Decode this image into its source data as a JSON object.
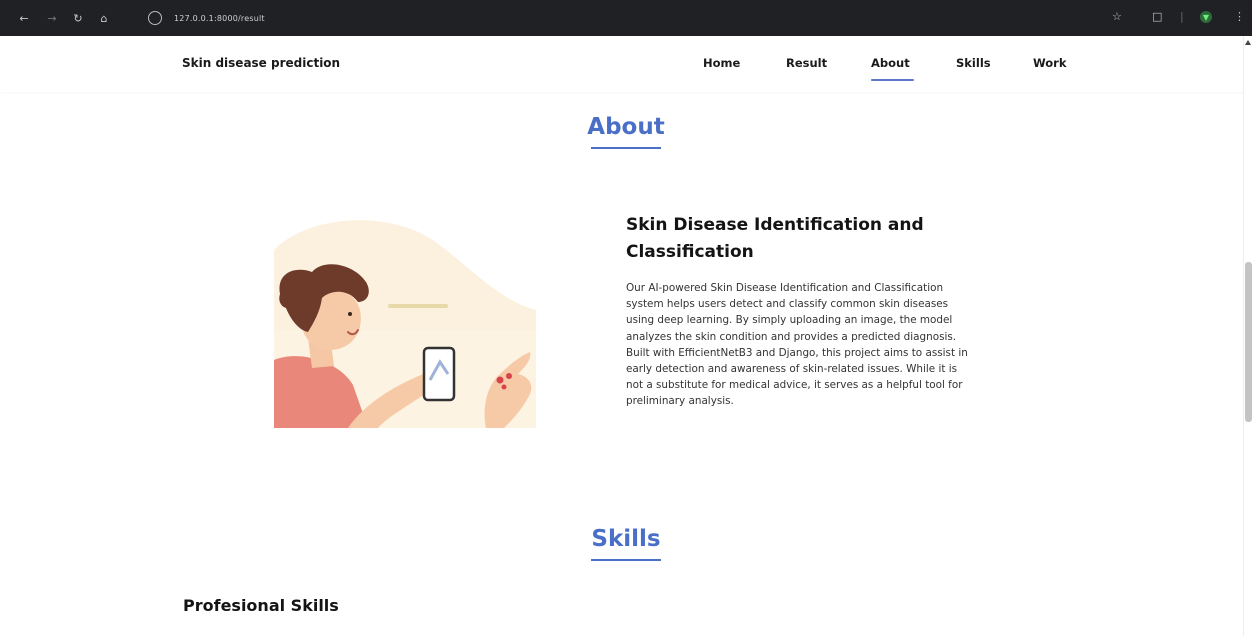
{
  "browser": {
    "url": "127.0.0.1:8000/result"
  },
  "header": {
    "brand": "Skin disease prediction",
    "nav": [
      "Home",
      "Result",
      "About",
      "Skills",
      "Work"
    ],
    "active_nav": "About"
  },
  "about": {
    "section_title": "About",
    "heading_line1": "Skin Disease Identification and",
    "heading_line2": "Classification",
    "body_lines": [
      "Our AI-powered Skin Disease Identification and Classification",
      "system helps users detect and classify common skin diseases",
      "using deep learning. By simply uploading an image, the model",
      "analyzes the skin condition and provides a predicted diagnosis.",
      "Built with EfficientNetB3 and Django, this project aims to assist in",
      "early detection and awareness of skin-related issues. While it is",
      "not a substitute for medical advice, it serves as a helpful tool for",
      "preliminary analysis."
    ]
  },
  "skills": {
    "section_title": "Skills",
    "subheading": "Profesional Skills"
  },
  "colors": {
    "accent": "#4a6fc7",
    "chrome_bg": "#202124"
  }
}
